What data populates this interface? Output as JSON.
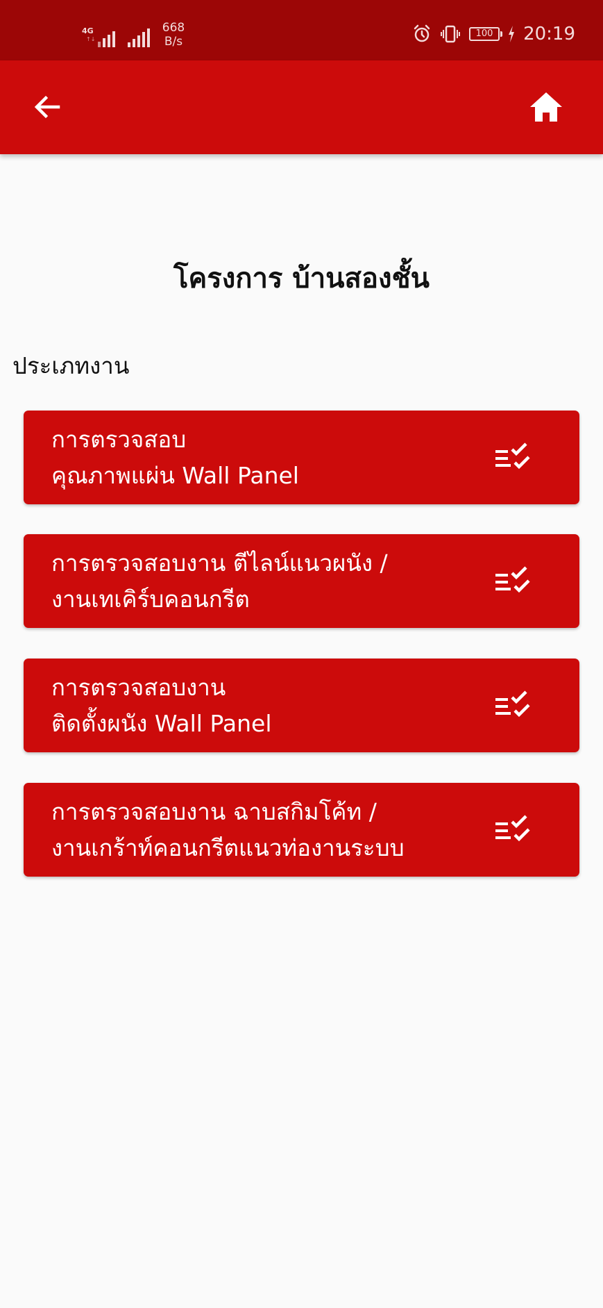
{
  "status_bar": {
    "network_type": "4G",
    "network_speed_value": "668",
    "network_speed_unit": "B/s",
    "battery_level": "100",
    "time": "20:19"
  },
  "app_bar": {
    "back_icon": "arrow-left-icon",
    "home_icon": "home-icon"
  },
  "page": {
    "title": "โครงการ บ้านสองชั้น",
    "section_label": "ประเภทงาน"
  },
  "items": [
    {
      "line1": "การตรวจสอบ",
      "line2": "คุณภาพแผ่น Wall Panel",
      "icon": "checklist-icon"
    },
    {
      "line1": "การตรวจสอบงาน ตีไลน์แนวผนัง /",
      "line2": "งานเทเคิร์บคอนกรีต",
      "icon": "checklist-icon"
    },
    {
      "line1": "การตรวจสอบงาน",
      "line2": "ติดตั้งผนัง Wall Panel",
      "icon": "checklist-icon"
    },
    {
      "line1": "การตรวจสอบงาน ฉาบสกิมโค้ท /",
      "line2": "งานเกร้าท์คอนกรีตแนวท่องานระบบ",
      "icon": "checklist-icon"
    }
  ],
  "colors": {
    "status_bar": "#9c0606",
    "app_bar": "#cc0b0b",
    "card": "#cc0b0b",
    "background": "#fafafa"
  }
}
